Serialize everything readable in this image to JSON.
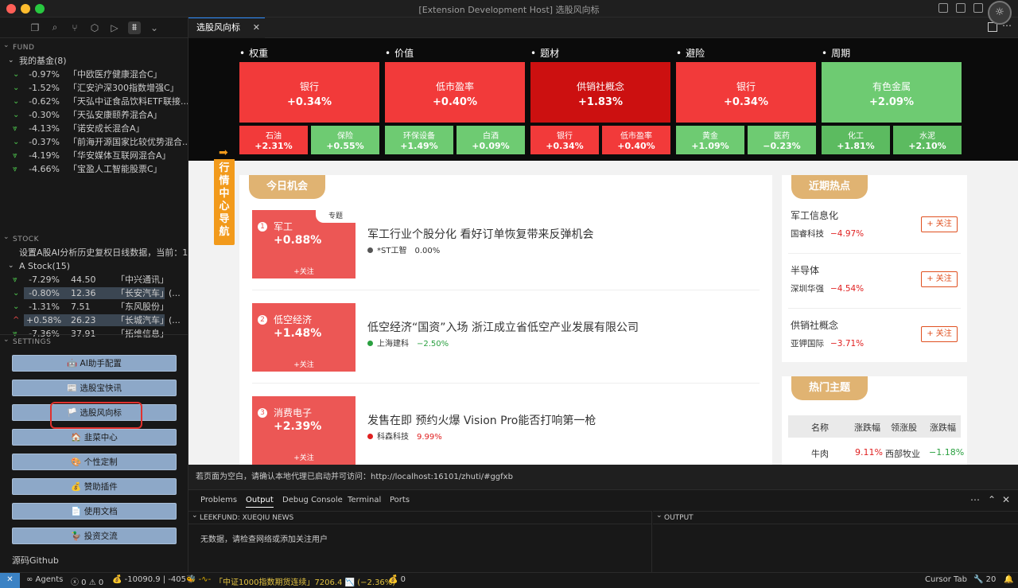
{
  "window": {
    "title": "[Extension Development Host] 选股风向标"
  },
  "editor_tab": {
    "label": "选股风向标",
    "close": "✕"
  },
  "activity_icons": [
    "files-icon",
    "search-icon",
    "branch-icon",
    "extensions-icon",
    "run-icon",
    "leekfund-icon",
    "chevron-down-icon"
  ],
  "fund": {
    "header": "FUND",
    "group": "我的基金(8)",
    "items": [
      {
        "arrow": "⌄",
        "pct": "-0.97%",
        "name": "「中欧医疗健康混合C」"
      },
      {
        "arrow": "⌄",
        "pct": "-1.52%",
        "name": "「汇安沪深300指数增强C」"
      },
      {
        "arrow": "⌄",
        "pct": "-0.62%",
        "name": "「天弘中证食品饮料ETF联接..."
      },
      {
        "arrow": "⌄",
        "pct": "-0.30%",
        "name": "「天弘安康颐养混合A」"
      },
      {
        "arrow": "⩔",
        "pct": "-4.13%",
        "name": "「诺安成长混合A」"
      },
      {
        "arrow": "⌄",
        "pct": "-0.37%",
        "name": "「前海开源国家比较优势混合..."
      },
      {
        "arrow": "⩔",
        "pct": "-4.19%",
        "name": "「华安媒体互联网混合A」"
      },
      {
        "arrow": "⩔",
        "pct": "-4.66%",
        "name": "「宝盈人工智能股票C」"
      }
    ]
  },
  "stock": {
    "header": "STOCK",
    "note": "设置A股AI分析历史复权日线数据，当前：1...",
    "group": "A Stock(15)",
    "items": [
      {
        "arrow": "⩔",
        "pct": "-7.29%",
        "price": "44.50",
        "name": "「中兴通讯」",
        "color": "#4ec94e",
        "hl": false
      },
      {
        "arrow": "⌄",
        "pct": "-0.80%",
        "price": "12.36",
        "name": "「长安汽车」(...",
        "color": "#4ec94e",
        "hl": true
      },
      {
        "arrow": "⌄",
        "pct": "-1.31%",
        "price": "7.51",
        "name": "「东风股份」",
        "color": "#4ec94e",
        "hl": false
      },
      {
        "arrow": "^",
        "pct": "+0.58%",
        "price": "26.23",
        "name": "「长城汽车」(...",
        "color": "#f14c4c",
        "hl": true
      },
      {
        "arrow": "⩔",
        "pct": "-7.36%",
        "price": "37.91",
        "name": "「拓维信息」",
        "color": "#4ec94e",
        "hl": false
      }
    ]
  },
  "settings": {
    "header": "SETTINGS",
    "buttons": [
      "🤖 AI助手配置",
      "📰 选股宝快讯",
      "🏳️ 选股风向标",
      "🏠 韭菜中心",
      "🎨 个性定制",
      "💰 赞助插件",
      "📄 使用文档",
      "🦆 投资交流"
    ],
    "source_link": "源码Github"
  },
  "webview": {
    "categories": [
      {
        "name": "权重",
        "big": {
          "name": "银行",
          "pct": "+0.34%",
          "color": "#f23a3a"
        },
        "small": [
          {
            "name": "石油",
            "pct": "+2.31%",
            "color": "#f23a3a"
          },
          {
            "name": "保险",
            "pct": "+0.55%",
            "color": "#6ecb72"
          }
        ]
      },
      {
        "name": "价值",
        "big": {
          "name": "低市盈率",
          "pct": "+0.40%",
          "color": "#f23a3a"
        },
        "small": [
          {
            "name": "环保设备",
            "pct": "+1.49%",
            "color": "#6ecb72"
          },
          {
            "name": "白酒",
            "pct": "+0.09%",
            "color": "#6ecb72"
          }
        ]
      },
      {
        "name": "题材",
        "big": {
          "name": "供销社概念",
          "pct": "+1.83%",
          "color": "#cc1010"
        },
        "small": [
          {
            "name": "银行",
            "pct": "+0.34%",
            "color": "#f23a3a"
          },
          {
            "name": "低市盈率",
            "pct": "+0.40%",
            "color": "#f23a3a"
          }
        ]
      },
      {
        "name": "避险",
        "big": {
          "name": "银行",
          "pct": "+0.34%",
          "color": "#f23a3a"
        },
        "small": [
          {
            "name": "黄金",
            "pct": "+1.09%",
            "color": "#6ecb72"
          },
          {
            "name": "医药",
            "pct": "−0.23%",
            "color": "#6ecb72"
          }
        ]
      },
      {
        "name": "周期",
        "big": {
          "name": "有色金属",
          "pct": "+2.09%",
          "color": "#6ecb72"
        },
        "small": [
          {
            "name": "化工",
            "pct": "+1.81%",
            "color": "#5cbb60"
          },
          {
            "name": "水泥",
            "pct": "+2.10%",
            "color": "#5cbb60"
          }
        ]
      }
    ],
    "side_nav": "行情中心导航",
    "today": {
      "title": "今日机会",
      "items": [
        {
          "num": "1",
          "name": "军工",
          "pct": "+0.88%",
          "follow": "+关注",
          "tag": "专题",
          "headline": "军工行业个股分化 看好订单恢复带来反弹机会",
          "stock": "*ST工智",
          "stock_pct": "0.00%",
          "dot": "#555",
          "pct_color": "#333"
        },
        {
          "num": "2",
          "name": "低空经济",
          "pct": "+1.48%",
          "follow": "+关注",
          "tag": "",
          "headline": "低空经济“国资”入场 浙江成立省低空产业发展有限公司",
          "stock": "上海建科",
          "stock_pct": "−2.50%",
          "dot": "#2aa040",
          "pct_color": "#2aa040"
        },
        {
          "num": "3",
          "name": "消费电子",
          "pct": "+2.39%",
          "follow": "+关注",
          "tag": "",
          "headline": "发售在即 预约火爆 Vision Pro能否打响第一枪",
          "stock": "科森科技",
          "stock_pct": "9.99%",
          "dot": "#e02020",
          "pct_color": "#e02020"
        }
      ]
    },
    "hot": {
      "title": "近期热点",
      "items": [
        {
          "topic": "军工信息化",
          "stock": "国睿科技",
          "pct": "−4.97%",
          "follow": "+ 关注"
        },
        {
          "topic": "半导体",
          "stock": "深圳华强",
          "pct": "−4.54%",
          "follow": "+ 关注"
        },
        {
          "topic": "供销社概念",
          "stock": "亚钾国际",
          "pct": "−3.71%",
          "follow": "+ 关注"
        }
      ]
    },
    "themes": {
      "title": "热门主题",
      "headers": [
        "名称",
        "涨跌幅",
        "领涨股",
        "涨跌幅"
      ],
      "row": [
        "牛肉",
        "9.11%",
        "西部牧业",
        "−1.18%"
      ]
    }
  },
  "proxy_msg": "若页面为空白，请确认本地代理已启动并可访问：http://localhost:16101/zhuti/#ggfxb",
  "panel": {
    "tabs": [
      "Problems",
      "Output",
      "Debug Console",
      "Terminal",
      "Ports"
    ],
    "active": "Output",
    "left_title": "LEEKFUND: XUEQIU NEWS",
    "left_body": "无数据，请检查网络或添加关注用户",
    "right_title": "OUTPUT"
  },
  "statusbar": {
    "remote": "✕",
    "agents": "∞ Agents",
    "problems": "ⓧ 0 ⚠ 0",
    "fund_total": "💰 -10090.9 | -405",
    "ticker": "「中证1000指数期货连续」7206.4 📉 (−2.36%)",
    "count": "💰 0",
    "cursor_tab": "Cursor Tab",
    "notif": "🔧 20",
    "bell": "🔔"
  }
}
